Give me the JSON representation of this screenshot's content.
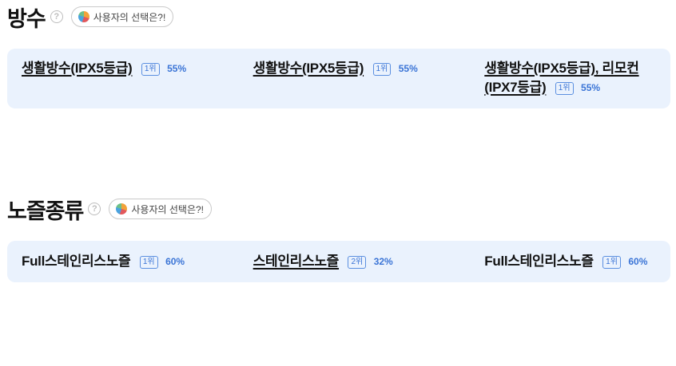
{
  "waterproof": {
    "title": "방수",
    "help_glyph": "?",
    "choice_label": "사용자의 선택은?!",
    "items": [
      {
        "label": "생활방수(IPX5등급)",
        "rank": "1위",
        "pct": "55%"
      },
      {
        "label": "생활방수(IPX5등급)",
        "rank": "1위",
        "pct": "55%"
      },
      {
        "label": "생활방수(IPX5등급), 리모컨(IPX7등급)",
        "rank": "1위",
        "pct": "55%"
      }
    ]
  },
  "exposure": {
    "title": "노즐종류",
    "help_glyph": "?",
    "choice_label": "사용자의 선택은?!",
    "items": [
      {
        "label": "Full스테인리스노즐",
        "rank": "1위",
        "pct": "60%"
      },
      {
        "label": "스테인리스노즐",
        "rank": "2위",
        "pct": "32%"
      },
      {
        "label": "Full스테인리스노즐",
        "rank": "1위",
        "pct": "60%"
      }
    ]
  }
}
